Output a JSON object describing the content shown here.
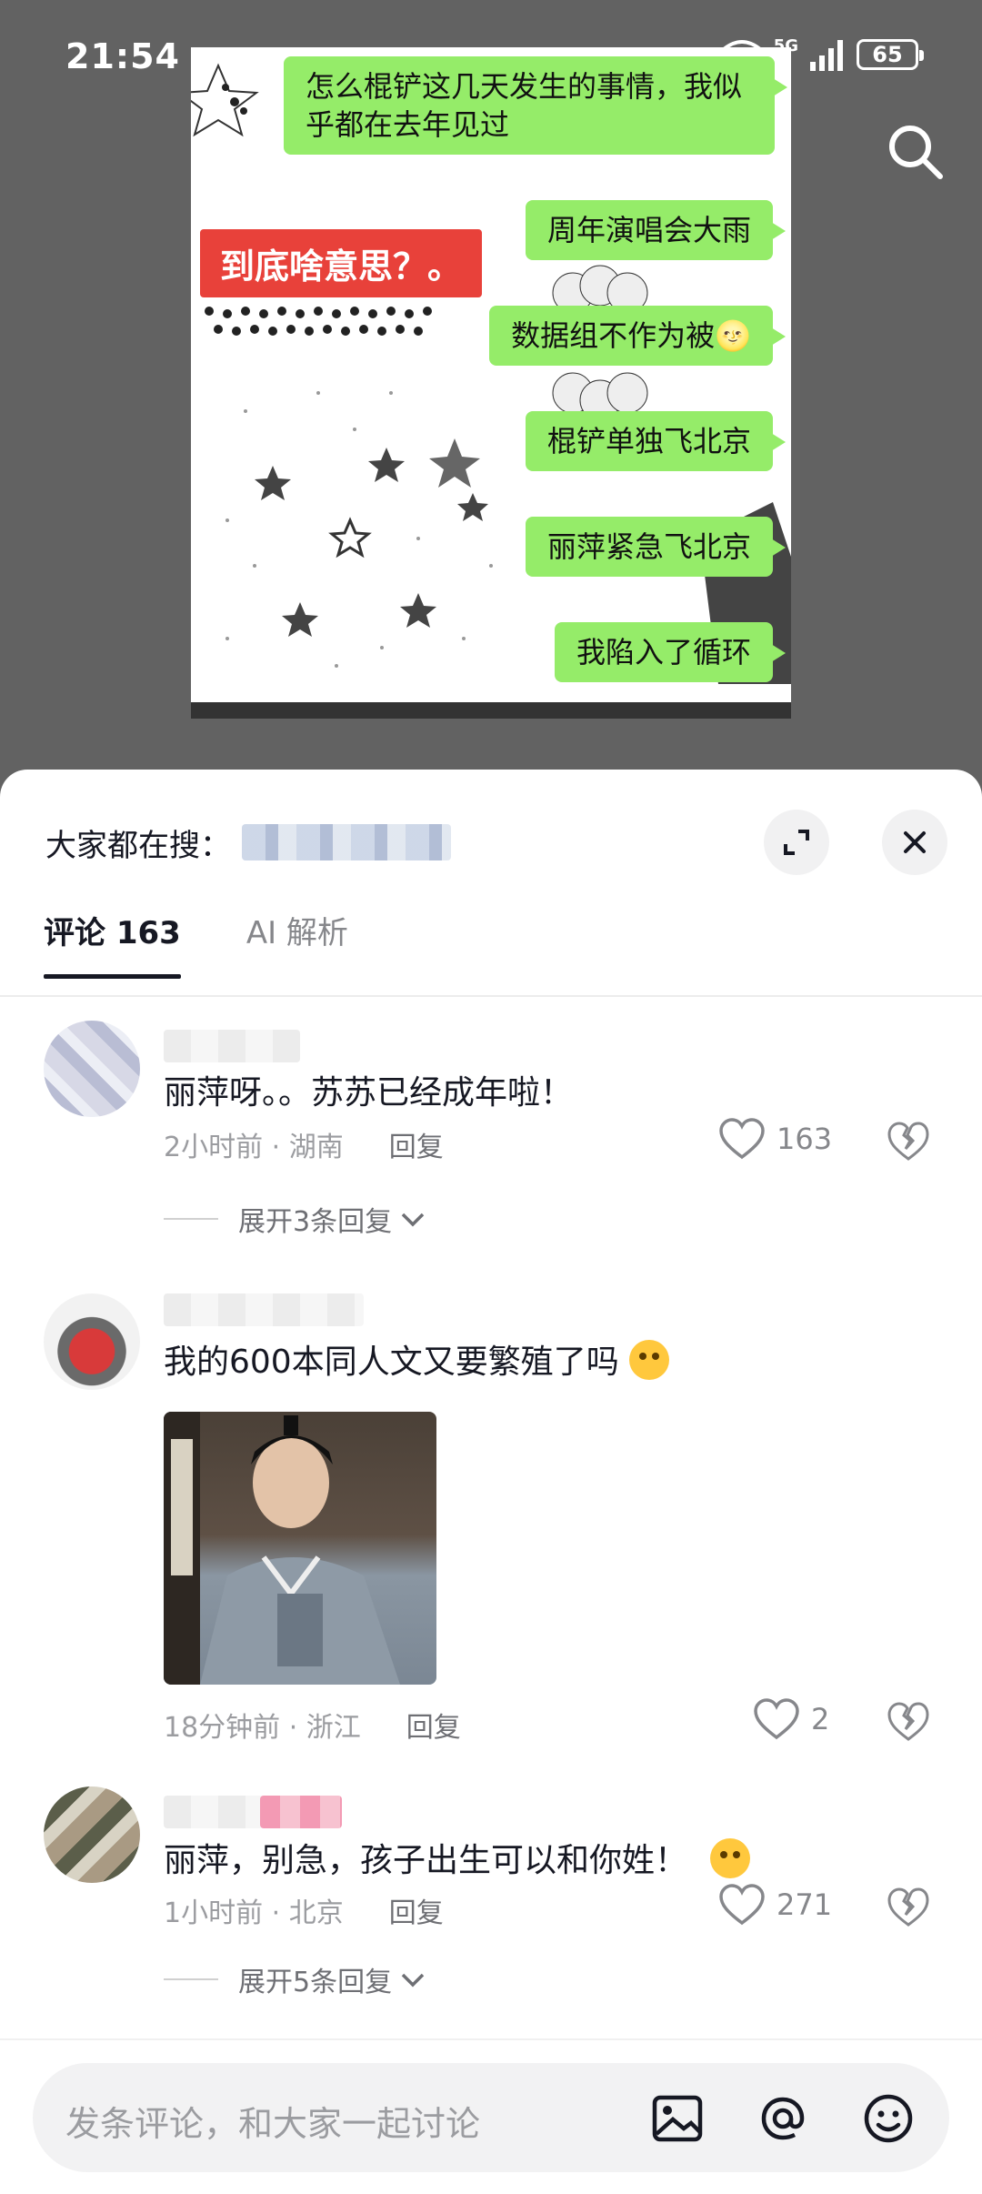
{
  "status_bar": {
    "time": "21:54",
    "network": "5G",
    "battery": "65"
  },
  "media": {
    "bubbles": [
      "怎么棍铲这几天发生的事情，我似乎都在去年见过",
      "周年演唱会大雨",
      "数据组不作为被🌝",
      "棍铲单独飞北京",
      "丽萍紧急飞北京",
      "我陷入了循环"
    ],
    "red_tag": "到底啥意思？。"
  },
  "sheet": {
    "search_label": "大家都在搜：",
    "tabs": [
      {
        "label": "评论 163",
        "active": true
      },
      {
        "label": "AI 解析",
        "active": false
      }
    ]
  },
  "comments": [
    {
      "text": "丽萍呀。。苏苏已经成年啦！",
      "time": "2小时前 · 湖南",
      "reply": "回复",
      "likes": "163",
      "expand": "展开3条回复"
    },
    {
      "text": "我的600本同人文又要繁殖了吗",
      "time": "18分钟前 · 浙江",
      "reply": "回复",
      "likes": "2"
    },
    {
      "text": "丽萍，别急，孩子出生可以和你姓！",
      "time": "1小时前 · 北京",
      "reply": "回复",
      "likes": "271",
      "expand": "展开5条回复"
    }
  ],
  "input": {
    "placeholder": "发条评论，和大家一起讨论"
  }
}
